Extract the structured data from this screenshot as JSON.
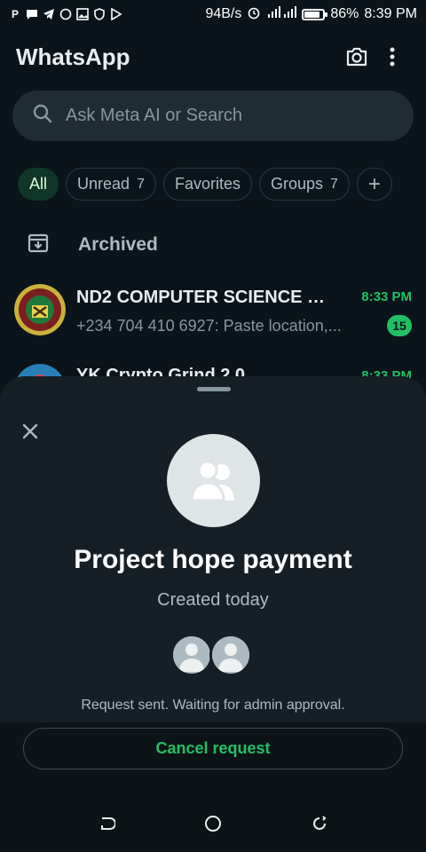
{
  "status_bar": {
    "left_icons": [
      "P",
      "chat-bubble",
      "telegram",
      "whatsapp",
      "image",
      "shield",
      "play-store"
    ],
    "speed": "94B/s",
    "battery": "86%",
    "time": "8:39 PM"
  },
  "header": {
    "title": "WhatsApp",
    "camera_icon": "camera-icon",
    "menu_icon": "more-vert-icon"
  },
  "search": {
    "placeholder": "Ask Meta AI or Search"
  },
  "filters": [
    {
      "label": "All",
      "count": "",
      "active": true
    },
    {
      "label": "Unread",
      "count": "7",
      "active": false
    },
    {
      "label": "Favorites",
      "count": "",
      "active": false
    },
    {
      "label": "Groups",
      "count": "7",
      "active": false
    }
  ],
  "filters_add": "+",
  "archived": {
    "label": "Archived"
  },
  "chats": [
    {
      "name": "ND2 COMPUTER SCIENCE 💻...",
      "time": "8:33 PM",
      "preview": "+234 704 410 6927: Paste location,...",
      "unread": "15"
    },
    {
      "name": "YK Crypto Grind 2.0",
      "time": "8:33 PM",
      "preview": "",
      "unread": ""
    }
  ],
  "sheet": {
    "title": "Project hope payment",
    "subtitle": "Created today",
    "note": "Request sent. Waiting for admin approval.",
    "cancel_label": "Cancel request"
  },
  "colors": {
    "background": "#0b141a",
    "accent": "#21c063",
    "sheet": "#161f26"
  }
}
